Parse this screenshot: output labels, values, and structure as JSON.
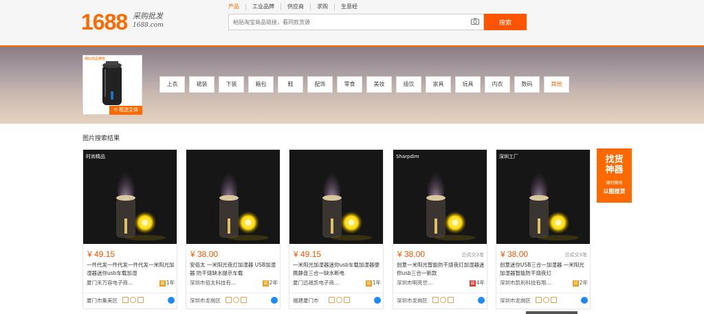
{
  "header": {
    "logo_number": "1688",
    "logo_sub": "采购批发",
    "logo_url": "1688.com",
    "nav": [
      "产品",
      "工业品牌",
      "供应商",
      "求购",
      "生意经"
    ],
    "search_placeholder": "粘贴淘宝商品链接，看同款货源",
    "search_button": "搜索"
  },
  "banner": {
    "thumb_tag": "相似商品推荐",
    "select_label": "框选主体",
    "categories": [
      "上衣",
      "裙装",
      "下装",
      "箱包",
      "鞋",
      "配饰",
      "零食",
      "美妆",
      "插饮",
      "家具",
      "玩具",
      "内衣",
      "数码",
      "其他"
    ],
    "active_category": "其他"
  },
  "results": {
    "title": "图片搜索结果",
    "items": [
      {
        "price": "¥ 49.15",
        "sold": "",
        "title": "一件代发一件代发一件代发一米阳光加湿器迷你usb车载加湿",
        "shop": "厦门禾万容电子商...",
        "years": "1年",
        "badge_red": false,
        "location": "厦门市集美区",
        "img_label": "时尚精品"
      },
      {
        "price": "¥ 38.00",
        "sold": "",
        "title": "安佰太 一米阳光夜灯加湿器 USB加湿器 防干烧缺水提示车载",
        "shop": "深圳市佰太科技有...",
        "years": "2年",
        "badge_red": false,
        "location": "深圳市龙岗区",
        "img_label": ""
      },
      {
        "price": "¥ 49.15",
        "sold": "",
        "title": "一米阳光加湿器迷你usb车载加湿器便携静音三合一缺水断电",
        "shop": "厦门迅晟凯电子商...",
        "years": "1年",
        "badge_red": false,
        "location": "福建厦门市",
        "img_label": ""
      },
      {
        "price": "¥ 38.00",
        "sold": "总成交3笔",
        "title": "创意一米阳光智能防干烧夜灯加湿器迷你usb三合一新款",
        "shop": "深圳市明亮世...",
        "years": "4年",
        "badge_red": true,
        "location": "深圳市龙岗区",
        "img_label": "Sharpdim"
      },
      {
        "price": "¥ 38.00",
        "sold": "总成交3笔",
        "title": "创意迷你USB三合一加湿器 一米阳光加湿器智能防干烧夜灯",
        "shop": "深圳市凯利科技有限...",
        "years": "2年",
        "badge_red": false,
        "location": "深圳市龙岗区",
        "img_label": "深圳工厂"
      }
    ]
  },
  "promo": {
    "title_line1": "找货",
    "title_line2": "神器",
    "sub1": "随时随地",
    "sub2": "以图搜货"
  },
  "colors": {
    "accent": "#ff6a00",
    "price": "#ff5500",
    "chat": "#1a8cff"
  }
}
